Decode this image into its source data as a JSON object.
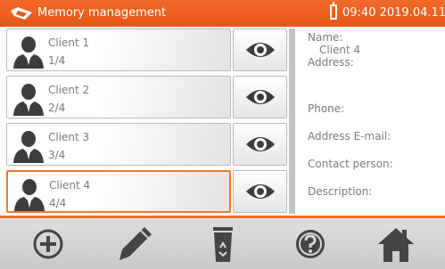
{
  "header": {
    "title": "Memory management",
    "datetime": "09:40 2019.04.11",
    "accent_color": "#ef6423"
  },
  "clients": [
    {
      "name": "Client 1",
      "count": "1/4",
      "selected": false
    },
    {
      "name": "Client 2",
      "count": "2/4",
      "selected": false
    },
    {
      "name": "Client 3",
      "count": "3/4",
      "selected": false
    },
    {
      "name": "Client 4",
      "count": "4/4",
      "selected": true
    }
  ],
  "details": {
    "name_label": "Name:",
    "name_value": "Client 4",
    "address_label": "Address:",
    "phone_label": "Phone:",
    "email_label": "Address E-mail:",
    "contact_label": "Contact person:",
    "description_label": "Description:"
  },
  "toolbar": {
    "buttons": [
      "add-icon",
      "edit-pencil-icon",
      "recycle-bin-icon",
      "help-icon",
      "home-icon"
    ]
  }
}
